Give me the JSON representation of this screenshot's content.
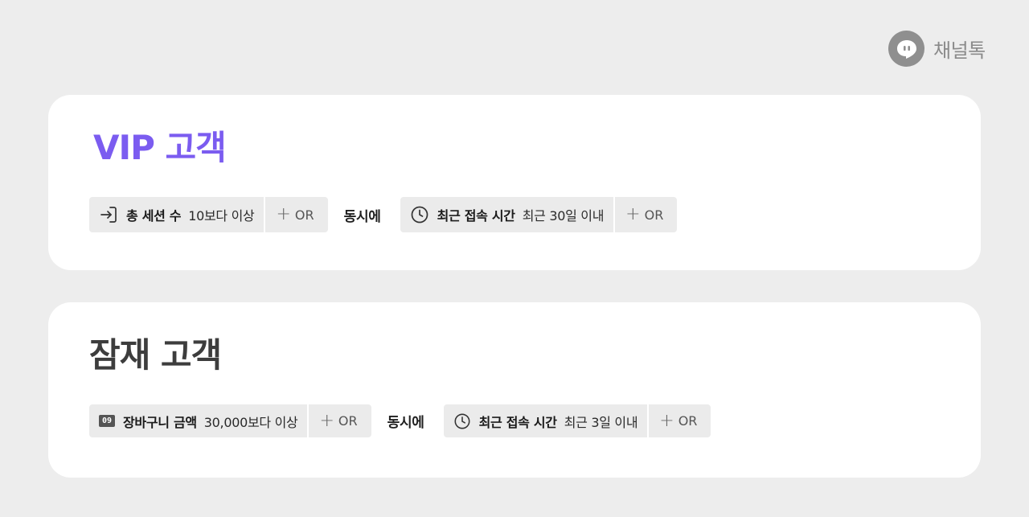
{
  "brand": {
    "name": "채널톡",
    "logo_icon": "chat-bubble-icon"
  },
  "segments": [
    {
      "title": "VIP 고객",
      "title_color": "#7b5cf0",
      "conditions": [
        {
          "icon": "sign-in-icon",
          "key": "총 세션 수",
          "value": "10보다 이상",
          "or_label": "OR"
        },
        {
          "icon": "clock-icon",
          "key": "최근 접속 시간",
          "value": "최근 30일 이내",
          "or_label": "OR"
        }
      ],
      "join_label": "동시에"
    },
    {
      "title": "잠재 고객",
      "title_color": "#3d3d3d",
      "conditions": [
        {
          "icon": "number-badge-icon",
          "icon_text": "09",
          "key": "장바구니 금액",
          "value": "30,000보다 이상",
          "or_label": "OR"
        },
        {
          "icon": "clock-icon",
          "key": "최근 접속 시간",
          "value": "최근 3일 이내",
          "or_label": "OR"
        }
      ],
      "join_label": "동시에"
    }
  ]
}
